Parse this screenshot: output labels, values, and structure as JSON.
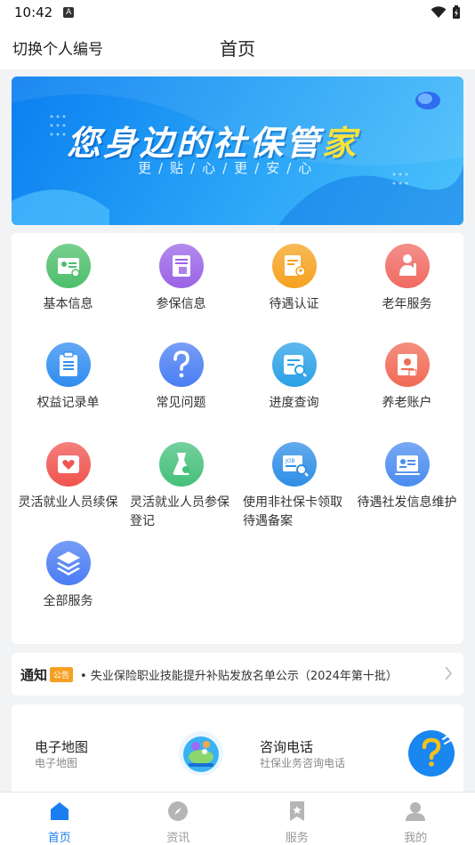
{
  "status": {
    "time": "10:42",
    "sim_label": "A"
  },
  "header": {
    "switch_label": "切换个人编号",
    "title": "首页"
  },
  "banner": {
    "headline_part1": "您身边的社保管",
    "headline_part2": "家",
    "subtitle": "更/贴/心/更/安/心"
  },
  "services": [
    {
      "label": "基本信息",
      "icon": "id-card-icon",
      "color": "#4cbf6a"
    },
    {
      "label": "参保信息",
      "icon": "insurance-doc-icon",
      "color": "#9a63e6"
    },
    {
      "label": "待遇认证",
      "icon": "certify-icon",
      "color": "#f5a21f"
    },
    {
      "label": "老年服务",
      "icon": "elder-icon",
      "color": "#f06a62"
    },
    {
      "label": "权益记录单",
      "icon": "clipboard-icon",
      "color": "#2f8cf0"
    },
    {
      "label": "常见问题",
      "icon": "question-icon",
      "color": "#4a7ef3"
    },
    {
      "label": "进度查询",
      "icon": "progress-search-icon",
      "color": "#2aa0e6"
    },
    {
      "label": "养老账户",
      "icon": "account-icon",
      "color": "#f06a55"
    },
    {
      "label": "灵活就业人员续保",
      "icon": "renew-heart-icon",
      "color": "#f0544f"
    },
    {
      "label": "灵活就业人员参保登记",
      "icon": "register-icon",
      "color": "#45c07a"
    },
    {
      "label": "使用非社保卡领取待遇备案",
      "icon": "job-search-icon",
      "color": "#2f8ee6"
    },
    {
      "label": "待遇社发信息维护",
      "icon": "profile-card-icon",
      "color": "#4a8cf0"
    },
    {
      "label": "全部服务",
      "icon": "layers-icon",
      "color": "#4a7cf3"
    }
  ],
  "notice": {
    "title": "通知",
    "tag": "公告",
    "text": "• 失业保险职业技能提升补贴发放名单公示（2024年第十批）"
  },
  "quick": [
    {
      "title": "电子地图",
      "subtitle": "电子地图"
    },
    {
      "title": "咨询电话",
      "subtitle": "社保业务咨询电话"
    }
  ],
  "tabs": [
    {
      "label": "首页",
      "icon": "home-icon",
      "active": true
    },
    {
      "label": "资讯",
      "icon": "compass-icon",
      "active": false
    },
    {
      "label": "服务",
      "icon": "bookmark-star-icon",
      "active": false
    },
    {
      "label": "我的",
      "icon": "person-icon",
      "active": false
    }
  ]
}
